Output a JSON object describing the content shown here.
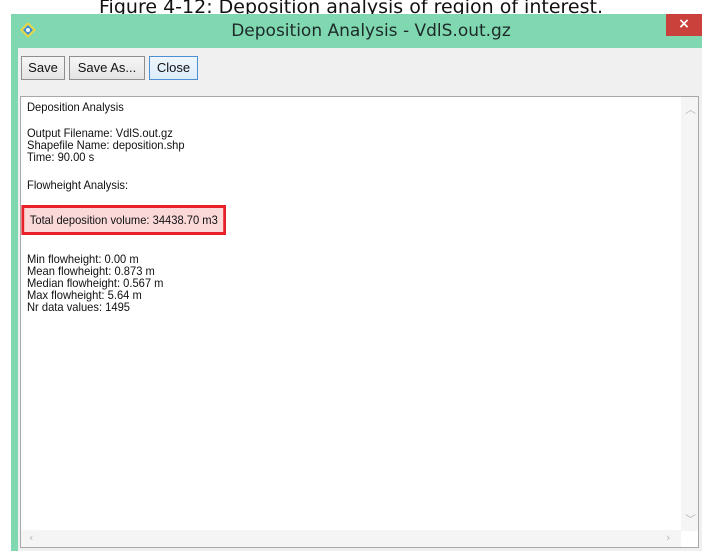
{
  "caption": "Figure 4-12: Deposition analysis of region of interest.",
  "window": {
    "title": "Deposition Analysis  - VdlS.out.gz",
    "close_glyph": "×"
  },
  "toolbar": {
    "save_label": "Save",
    "save_as_label": "Save As...",
    "close_label": "Close"
  },
  "report": {
    "heading": "Deposition Analysis",
    "output_filename": "Output Filename: VdlS.out.gz",
    "shapefile_name": "Shapefile Name: deposition.shp",
    "time": "Time: 90.00 s",
    "section": "Flowheight Analysis:",
    "total_volume": "Total deposition volume: 34438.70 m3",
    "min_flowheight": "Min flowheight: 0.00 m",
    "mean_flowheight": "Mean flowheight: 0.873 m",
    "median_flowheight": "Median flowheight: 0.567 m",
    "max_flowheight": "Max flowheight: 5.64 m",
    "nr_values": "Nr data values: 1495"
  },
  "colors": {
    "titlebar": "#7fd8b0",
    "close_button": "#c9413a",
    "highlight_border": "#e8202a",
    "highlight_fill": "#fbd9d9"
  },
  "icons": {
    "app": "app-icon",
    "close": "close-icon",
    "scroll_up": "scroll-up-arrow-icon",
    "scroll_down": "scroll-down-arrow-icon",
    "scroll_left": "scroll-left-arrow-icon",
    "scroll_right": "scroll-right-arrow-icon"
  }
}
